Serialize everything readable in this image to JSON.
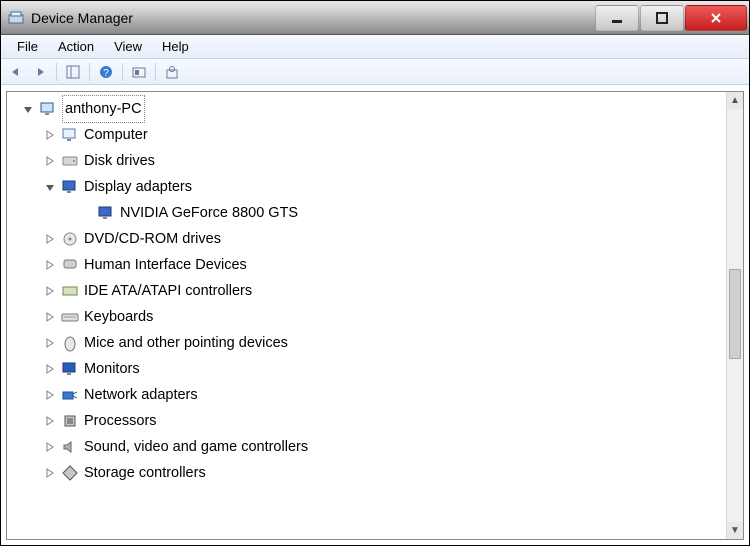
{
  "window": {
    "title": "Device Manager"
  },
  "menu": {
    "file": "File",
    "action": "Action",
    "view": "View",
    "help": "Help"
  },
  "tree": {
    "root": "anthony-PC",
    "categories": [
      {
        "label": "Computer",
        "expanded": false
      },
      {
        "label": "Disk drives",
        "expanded": false
      },
      {
        "label": "Display adapters",
        "expanded": true,
        "children": [
          {
            "label": "NVIDIA GeForce 8800 GTS"
          }
        ]
      },
      {
        "label": "DVD/CD-ROM drives",
        "expanded": false
      },
      {
        "label": "Human Interface Devices",
        "expanded": false
      },
      {
        "label": "IDE ATA/ATAPI controllers",
        "expanded": false
      },
      {
        "label": "Keyboards",
        "expanded": false
      },
      {
        "label": "Mice and other pointing devices",
        "expanded": false
      },
      {
        "label": "Monitors",
        "expanded": false
      },
      {
        "label": "Network adapters",
        "expanded": false
      },
      {
        "label": "Processors",
        "expanded": false
      },
      {
        "label": "Sound, video and game controllers",
        "expanded": false
      },
      {
        "label": "Storage controllers",
        "expanded": false
      }
    ]
  }
}
